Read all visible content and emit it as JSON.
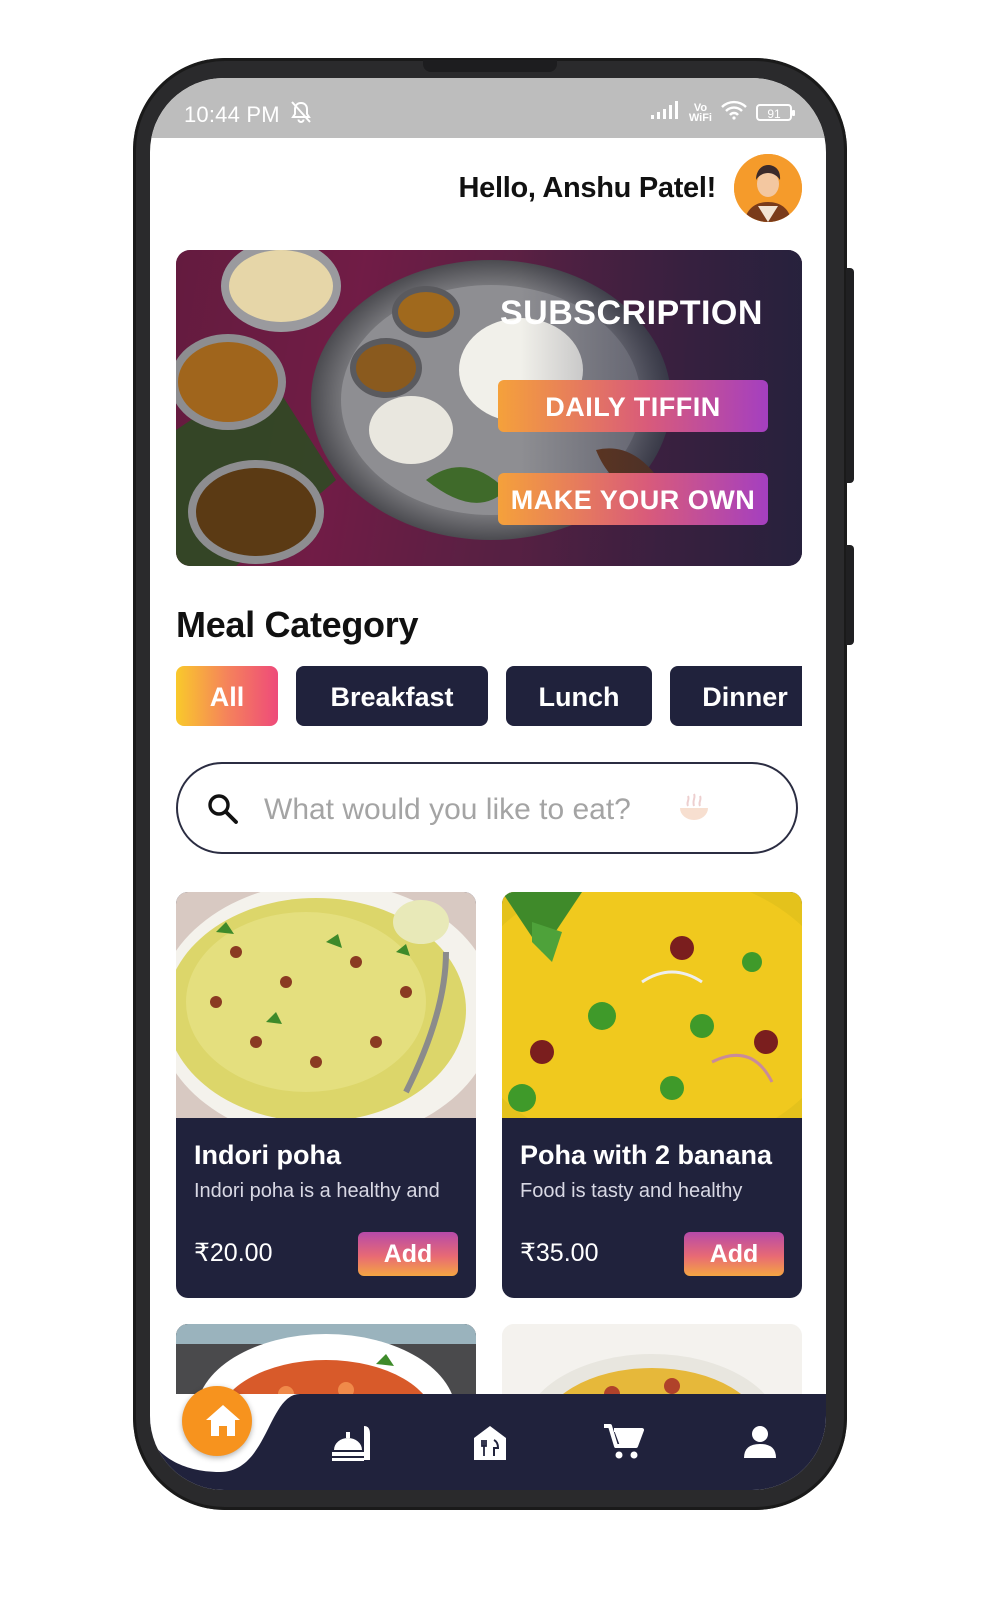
{
  "status_bar": {
    "time": "10:44 PM",
    "network_label_top": "Vo",
    "network_label_bottom": "WiFi",
    "battery": "91"
  },
  "header": {
    "greeting": "Hello, Anshu Patel!"
  },
  "banner": {
    "title": "SUBSCRIPTION",
    "daily_button": "DAILY TIFFIN",
    "own_button": "MAKE YOUR OWN"
  },
  "categories": {
    "title": "Meal Category",
    "items": [
      "All",
      "Breakfast",
      "Lunch",
      "Dinner"
    ],
    "selected": "All"
  },
  "search": {
    "placeholder": "What would you like to eat?"
  },
  "meals": [
    {
      "name": "Indori poha",
      "description": "Indori poha is a healthy and",
      "price": "₹20.00",
      "add_label": "Add"
    },
    {
      "name": "Poha with 2 banana",
      "description": "Food is tasty and healthy",
      "price": "₹35.00",
      "add_label": "Add"
    }
  ],
  "colors": {
    "navy": "#20223c",
    "accent_orange": "#f7931e",
    "gradient_start": "#f5a13b",
    "gradient_end": "#a43fc0"
  },
  "nav": {
    "items": [
      "home-icon",
      "meals-icon",
      "kitchen-icon",
      "cart-icon",
      "profile-icon"
    ],
    "active": "home-icon"
  }
}
